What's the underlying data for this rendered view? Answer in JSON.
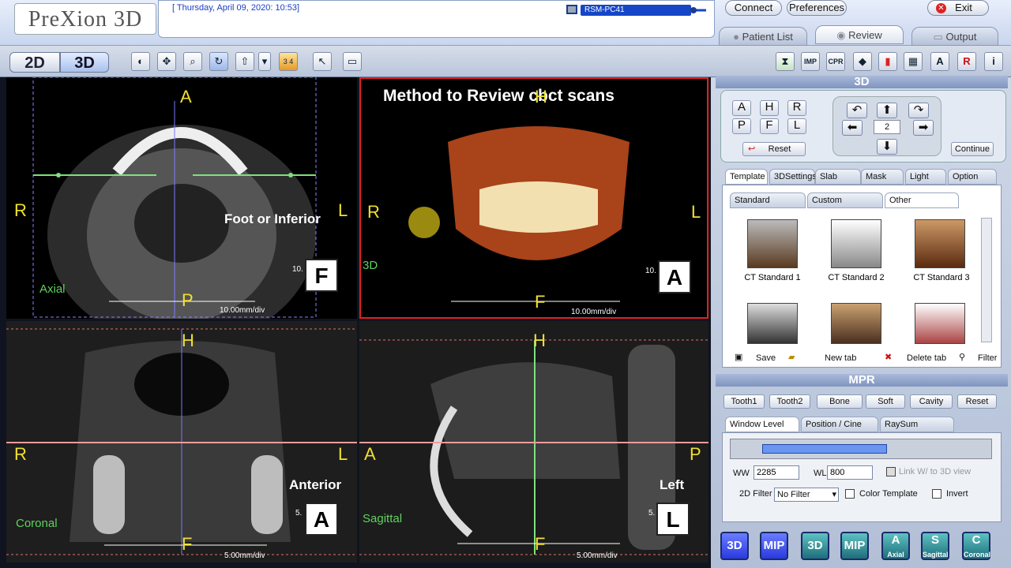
{
  "app": {
    "logo": "PreXion 3D",
    "datetime": "[ Thursday, April 09, 2020: 10:53]",
    "pc_name": "RSM-PC41"
  },
  "top_buttons": {
    "connect": "Connect",
    "preferences": "Preferences",
    "exit": "Exit"
  },
  "tabs": {
    "patient_list": "Patient List",
    "review": "Review",
    "output": "Output"
  },
  "toolbar": {
    "mode_2d": "2D",
    "mode_3d": "3D",
    "layout_label": "3 4"
  },
  "right_toolbar": {
    "imp": "IMP",
    "cpr": "CPR",
    "a_icon": "A",
    "r_icon": "R",
    "info_icon": "i"
  },
  "viewports": {
    "axial": {
      "top": "A",
      "left": "R",
      "right": "L",
      "bottom": "P",
      "overlay": "Foot or Inferior",
      "name": "Axial",
      "scale": "10.00mm/div",
      "scale_tick": "10.",
      "orient": "F"
    },
    "vr3d": {
      "title": "Method to Review cbct scans",
      "top": "H",
      "left": "R",
      "right": "L",
      "bottom": "F",
      "name": "3D",
      "scale": "10.00mm/div",
      "scale_tick": "10.",
      "orient": "A"
    },
    "coronal": {
      "top": "H",
      "left": "R",
      "right": "L",
      "bottom": "F",
      "overlay": "Anterior",
      "name": "Coronal",
      "scale": "5.00mm/div",
      "scale_tick": "5.",
      "orient": "A"
    },
    "sagittal": {
      "top": "H",
      "left": "A",
      "right": "P",
      "bottom": "F",
      "overlay": "Left",
      "name": "Sagittal",
      "scale": "5.00mm/div",
      "scale_tick": "5.",
      "orient": "L"
    }
  },
  "panel_3d": {
    "header": "3D",
    "views": [
      "A",
      "H",
      "R",
      "P",
      "F",
      "L"
    ],
    "reset": "Reset",
    "step": "2",
    "continue": "Continue",
    "tabs": [
      "Template",
      "3DSettings",
      "Slab",
      "Mask",
      "Light",
      "Option"
    ],
    "subtabs": [
      "Standard",
      "Custom",
      "Other"
    ],
    "thumbs": [
      "CT Standard 1",
      "CT Standard 2",
      "CT Standard 3"
    ],
    "footer": {
      "save": "Save",
      "new_tab": "New tab",
      "delete_tab": "Delete tab",
      "filter": "Filter"
    }
  },
  "panel_mpr": {
    "header": "MPR",
    "buttons": [
      "Tooth1",
      "Tooth2",
      "Bone",
      "Soft",
      "Cavity",
      "Reset"
    ],
    "tabs": [
      "Window Level",
      "Position / Cine",
      "RaySum"
    ],
    "ww_label": "WW",
    "ww_value": "2285",
    "wl_label": "WL",
    "wl_value": "800",
    "link_label": "Link W/ to 3D view",
    "filter_label": "2D Filter",
    "filter_value": "No Filter",
    "color_template": "Color Template",
    "invert": "Invert"
  },
  "bottom_buttons": [
    {
      "label": "3D",
      "sub": ""
    },
    {
      "label": "MIP",
      "sub": ""
    },
    {
      "label": "3D",
      "sub": ""
    },
    {
      "label": "MIP",
      "sub": ""
    },
    {
      "label": "A",
      "sub": "Axial"
    },
    {
      "label": "S",
      "sub": "Sagittal"
    },
    {
      "label": "C",
      "sub": "Coronal"
    }
  ],
  "colors": {
    "accent_blue": "#1546c8",
    "label_yellow": "#f0e030",
    "name_green": "#5ed35e",
    "active_border": "#e02020"
  }
}
